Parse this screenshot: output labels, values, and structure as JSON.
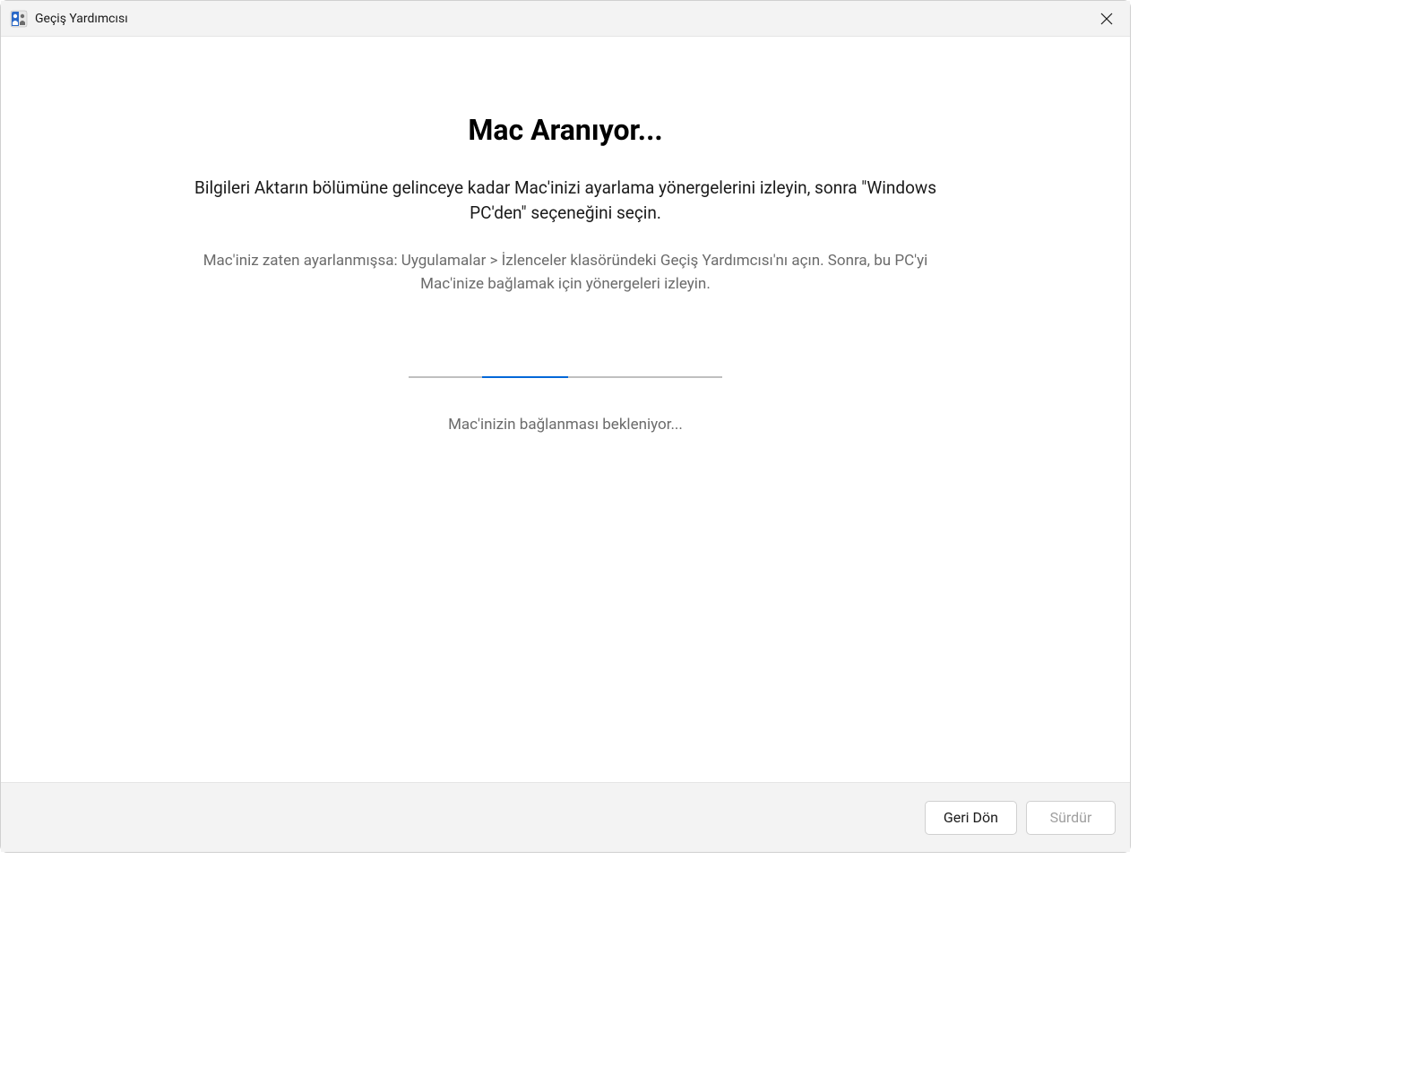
{
  "titlebar": {
    "app_name": "Geçiş Yardımcısı"
  },
  "main": {
    "heading": "Mac Aranıyor...",
    "instruction_primary": "Bilgileri Aktarın bölümüne gelinceye kadar Mac'inizi ayarlama yönergelerini izleyin, sonra \"Windows PC'den\" seçeneğini seçin.",
    "instruction_secondary": "Mac'iniz zaten ayarlanmışsa: Uygulamalar > İzlenceler klasöründeki Geçiş Yardımcısı'nı açın. Sonra, bu PC'yi Mac'inize bağlamak için yönergeleri izleyin.",
    "status_text": "Mac'inizin bağlanması bekleniyor..."
  },
  "footer": {
    "back_button": "Geri Dön",
    "continue_button": "Sürdür"
  }
}
